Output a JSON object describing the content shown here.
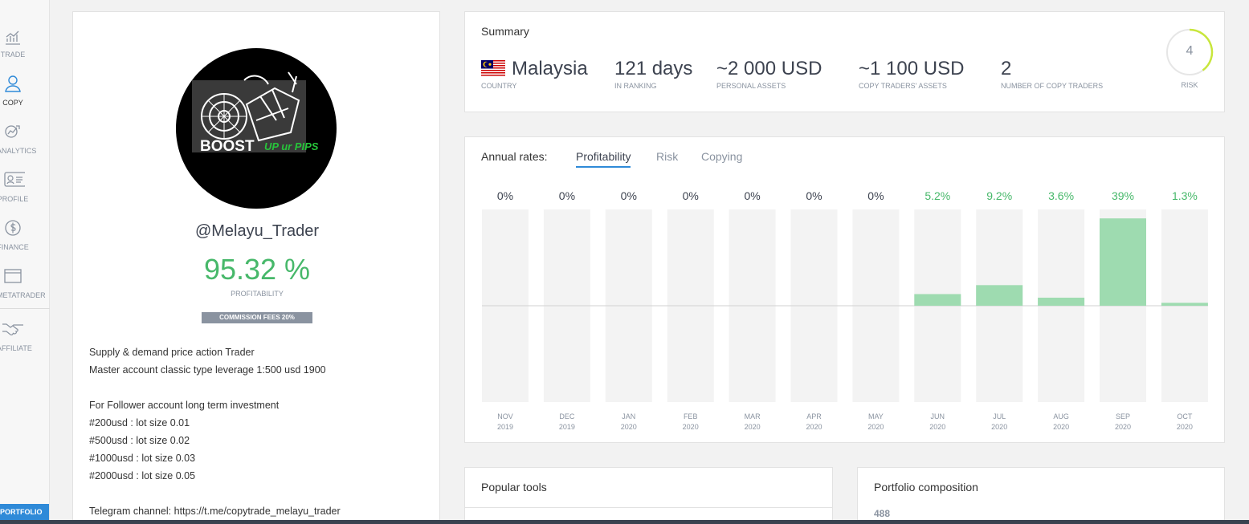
{
  "sidebar": {
    "items": [
      {
        "label": "TRADE",
        "icon": "chart-icon"
      },
      {
        "label": "COPY",
        "icon": "copy-user-icon"
      },
      {
        "label": "ANALYTICS",
        "icon": "analytics-icon"
      },
      {
        "label": "PROFILE",
        "icon": "profile-card-icon"
      },
      {
        "label": "FINANCE",
        "icon": "dollar-icon"
      },
      {
        "label": "METATRADER",
        "icon": "window-icon"
      },
      {
        "label": "AFFILIATE",
        "icon": "handshake-icon"
      }
    ],
    "portfolio_label": "PORTFOLIO",
    "accent": "#2f8ad8"
  },
  "profile": {
    "avatar_logo_text": "BOOST",
    "avatar_logo_subtext": "UP ur PIPS",
    "username": "@Melayu_Trader",
    "profitability": "95.32 %",
    "profitability_label": "PROFITABILITY",
    "commission": "COMMISSION FEES 20%",
    "description": [
      "Supply & demand price action Trader",
      "Master account classic type leverage 1:500 usd 1900",
      "",
      "For Follower account long term investment",
      "#200usd : lot size 0.01",
      "#500usd : lot size 0.02",
      "#1000usd : lot size 0.03",
      "#2000usd : lot size 0.05",
      "",
      "Telegram channel: https://t.me/copytrade_melayu_trader"
    ]
  },
  "summary": {
    "title": "Summary",
    "country": {
      "value": "Malaysia",
      "label": "COUNTRY"
    },
    "ranking": {
      "value": "121 days",
      "label": "IN RANKING"
    },
    "personal_assets": {
      "value": "~2 000 USD",
      "label": "PERSONAL ASSETS"
    },
    "copy_assets": {
      "value": "~1 100 USD",
      "label": "COPY TRADERS' ASSETS"
    },
    "copy_traders": {
      "value": "2",
      "label": "NUMBER OF COPY TRADERS"
    },
    "risk": {
      "value": "4",
      "label": "RISK",
      "level_fraction": 0.4,
      "color": "#c8e63c"
    }
  },
  "rates": {
    "title": "Annual rates:",
    "tabs": [
      {
        "label": "Profitability",
        "active": true
      },
      {
        "label": "Risk",
        "active": false
      },
      {
        "label": "Copying",
        "active": false
      }
    ]
  },
  "chart_data": {
    "type": "bar",
    "categories": [
      "NOV 2019",
      "DEC 2019",
      "JAN 2020",
      "FEB 2020",
      "MAR 2020",
      "APR 2020",
      "MAY 2020",
      "JUN 2020",
      "JUL 2020",
      "AUG 2020",
      "SEP 2020",
      "OCT 2020"
    ],
    "months": [
      "NOV",
      "DEC",
      "JAN",
      "FEB",
      "MAR",
      "APR",
      "MAY",
      "JUN",
      "JUL",
      "AUG",
      "SEP",
      "OCT"
    ],
    "years": [
      "2019",
      "2019",
      "2020",
      "2020",
      "2020",
      "2020",
      "2020",
      "2020",
      "2020",
      "2020",
      "2020",
      "2020"
    ],
    "values": [
      0,
      0,
      0,
      0,
      0,
      0,
      0,
      5.2,
      9.2,
      3.6,
      39,
      1.3
    ],
    "labels": [
      "0%",
      "0%",
      "0%",
      "0%",
      "0%",
      "0%",
      "0%",
      "5.2%",
      "9.2%",
      "3.6%",
      "39%",
      "1.3%"
    ],
    "ylim": [
      -43,
      43
    ],
    "colors": {
      "positive": "#9edbb0",
      "label_positive": "#47b86a",
      "label_zero": "#3d4350",
      "track": "#f3f3f3"
    }
  },
  "popular_tools": {
    "title": "Popular tools"
  },
  "portfolio_composition": {
    "title": "Portfolio composition",
    "value": "488"
  }
}
